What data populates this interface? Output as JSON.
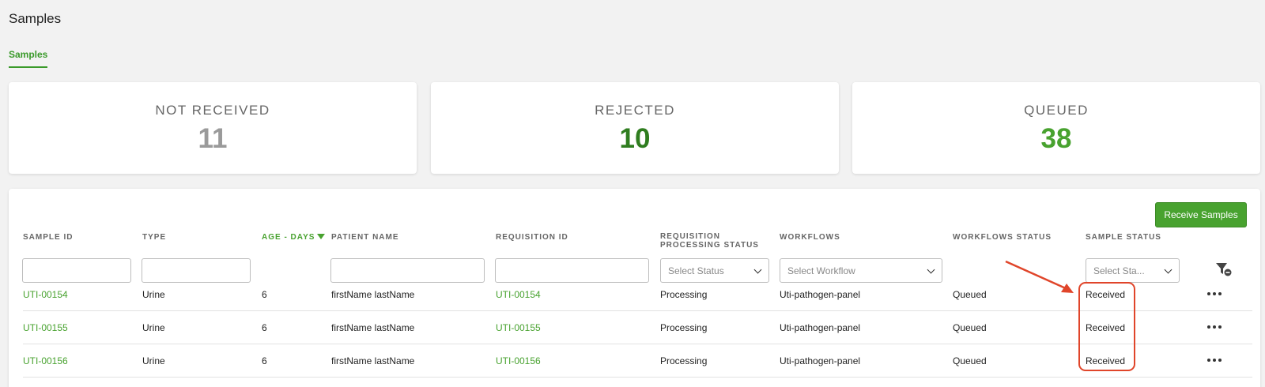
{
  "page": {
    "title": "Samples"
  },
  "tabs": [
    {
      "label": "Samples",
      "active": true
    }
  ],
  "stats": [
    {
      "label": "NOT RECEIVED",
      "value": "11",
      "color": "#9a9a9a"
    },
    {
      "label": "REJECTED",
      "value": "10",
      "color": "#2f7d1f"
    },
    {
      "label": "QUEUED",
      "value": "38",
      "color": "#48a22f"
    }
  ],
  "toolbar": {
    "receive_label": "Receive Samples"
  },
  "columns": [
    {
      "label": "SAMPLE ID"
    },
    {
      "label": "TYPE"
    },
    {
      "label": "AGE - DAYS",
      "sorted": "desc"
    },
    {
      "label": "PATIENT NAME"
    },
    {
      "label": "REQUISITION ID"
    },
    {
      "label": "REQUISITION PROCESSING STATUS"
    },
    {
      "label": "WORKFLOWS"
    },
    {
      "label": "WORKFLOWS STATUS"
    },
    {
      "label": "SAMPLE STATUS"
    }
  ],
  "filters": {
    "sample_id": "",
    "type": "",
    "patient_name": "",
    "requisition_id": "",
    "req_status_placeholder": "Select Status",
    "workflow_placeholder": "Select Workflow",
    "sample_status_placeholder": "Select Sta..."
  },
  "rows": [
    {
      "sample_id": "UTI-00154",
      "type": "Urine",
      "age": "6",
      "patient": "firstName lastName",
      "req_id": "UTI-00154",
      "req_status": "Processing",
      "workflow": "Uti-pathogen-panel",
      "wf_status": "Queued",
      "sample_status": "Received"
    },
    {
      "sample_id": "UTI-00155",
      "type": "Urine",
      "age": "6",
      "patient": "firstName lastName",
      "req_id": "UTI-00155",
      "req_status": "Processing",
      "workflow": "Uti-pathogen-panel",
      "wf_status": "Queued",
      "sample_status": "Received"
    },
    {
      "sample_id": "UTI-00156",
      "type": "Urine",
      "age": "6",
      "patient": "firstName lastName",
      "req_id": "UTI-00156",
      "req_status": "Processing",
      "workflow": "Uti-pathogen-panel",
      "wf_status": "Queued",
      "sample_status": "Received"
    }
  ],
  "colors": {
    "accent": "#48a22f",
    "annotation": "#e0452a"
  },
  "icons": {
    "filter_clear": "filter-clear-icon",
    "row_menu": "more-horizontal-icon"
  }
}
